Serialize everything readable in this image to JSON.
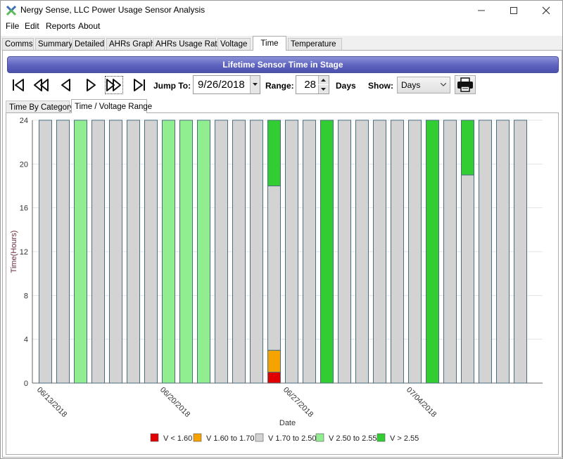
{
  "window": {
    "title": "Nergy Sense, LLC Power Usage Sensor Analysis",
    "minimize_icon": "minimize-icon",
    "maximize_icon": "maximize-icon",
    "close_icon": "close-icon"
  },
  "menu": [
    "File",
    "Edit",
    "Reports",
    "About"
  ],
  "main_tabs": [
    "Comms",
    "Summary",
    "Detailed",
    "AHRs Graph",
    "AHRs Usage Ratio",
    "Voltage",
    "Time",
    "Temperature"
  ],
  "active_main_tab": "Time",
  "banner": "Lifetime Sensor Time in Stage",
  "toolbar": {
    "jump_to_label": "Jump To:",
    "date_value": "9/26/2018",
    "range_label": "Range:",
    "range_value": "28",
    "days_label": "Days",
    "show_label": "Show:",
    "show_value": "Days",
    "icons": [
      "first-icon",
      "rewind-icon",
      "previous-icon",
      "next-icon",
      "fast-forward-icon",
      "last-icon",
      "printer-icon"
    ]
  },
  "sub_tabs": [
    "Time By Category",
    "Time / Voltage Range"
  ],
  "active_sub_tab": "Time / Voltage Range",
  "colors": {
    "v_lt_160": "#e00000",
    "v_160_170": "#f5a300",
    "v_170_250": "#d3d3d3",
    "v_250_255": "#90ee90",
    "v_gt_255": "#32cd32",
    "banner": "#5d63be"
  },
  "chart_data": {
    "type": "bar",
    "stacked": true,
    "xlabel": "Date",
    "ylabel": "Time(Hours)",
    "ylim": [
      0,
      24
    ],
    "yticks": [
      0,
      4,
      8,
      12,
      16,
      20,
      24
    ],
    "grid": true,
    "legend_position": "bottom",
    "x_tick_labels": [
      "06/13/2018",
      "06/20/2018",
      "06/27/2018",
      "07/04/2018"
    ],
    "x_tick_indices": [
      0,
      7,
      14,
      21
    ],
    "categories": [
      "06/13/2018",
      "06/14/2018",
      "06/15/2018",
      "06/16/2018",
      "06/17/2018",
      "06/18/2018",
      "06/19/2018",
      "06/20/2018",
      "06/21/2018",
      "06/22/2018",
      "06/23/2018",
      "06/24/2018",
      "06/25/2018",
      "06/26/2018",
      "06/27/2018",
      "06/28/2018",
      "06/29/2018",
      "06/30/2018",
      "07/01/2018",
      "07/02/2018",
      "07/03/2018",
      "07/04/2018",
      "07/05/2018",
      "07/06/2018",
      "07/07/2018",
      "07/08/2018",
      "07/09/2018",
      "07/10/2018"
    ],
    "series": [
      {
        "name": "V < 1.60",
        "color": "#e00000",
        "values": [
          0,
          0,
          0,
          0,
          0,
          0,
          0,
          0,
          0,
          0,
          0,
          0,
          0,
          1,
          0,
          0,
          0,
          0,
          0,
          0,
          0,
          0,
          0,
          0,
          0,
          0,
          0,
          0
        ]
      },
      {
        "name": "V 1.60 to 1.70",
        "color": "#f5a300",
        "values": [
          0,
          0,
          0,
          0,
          0,
          0,
          0,
          0,
          0,
          0,
          0,
          0,
          0,
          2,
          0,
          0,
          0,
          0,
          0,
          0,
          0,
          0,
          0,
          0,
          0,
          0,
          0,
          0
        ]
      },
      {
        "name": "V 1.70 to 2.50",
        "color": "#d3d3d3",
        "values": [
          24,
          24,
          0,
          24,
          24,
          24,
          24,
          0,
          0,
          0,
          24,
          24,
          24,
          15,
          24,
          24,
          0,
          24,
          24,
          24,
          24,
          24,
          0,
          24,
          19,
          24,
          24,
          24
        ]
      },
      {
        "name": "V 2.50 to 2.55",
        "color": "#90ee90",
        "values": [
          0,
          0,
          24,
          0,
          0,
          0,
          0,
          24,
          24,
          24,
          0,
          0,
          0,
          0,
          0,
          0,
          0,
          0,
          0,
          0,
          0,
          0,
          0,
          0,
          0,
          0,
          0,
          0
        ]
      },
      {
        "name": "V > 2.55",
        "color": "#32cd32",
        "values": [
          0,
          0,
          0,
          0,
          0,
          0,
          0,
          0,
          0,
          0,
          0,
          0,
          0,
          6,
          0,
          0,
          24,
          0,
          0,
          0,
          0,
          0,
          24,
          0,
          5,
          0,
          0,
          0
        ]
      }
    ]
  }
}
